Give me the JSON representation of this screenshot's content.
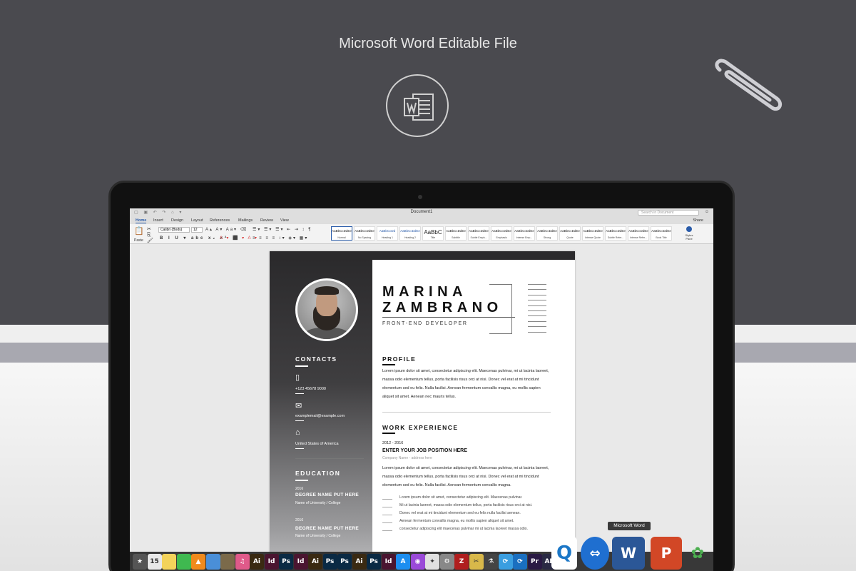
{
  "banner": {
    "headline": "Microsoft Word Editable File"
  },
  "word_window": {
    "title": "Document1",
    "search_placeholder": "Search in Document",
    "tabs": [
      "Home",
      "Insert",
      "Design",
      "Layout",
      "References",
      "Mailings",
      "Review",
      "View"
    ],
    "active_tab": "Home",
    "share_label": "Share",
    "paste_label": "Paste",
    "font_name": "Calibri (Body)",
    "font_size": "12",
    "styles": [
      {
        "sample": "AaBbCcDdEe",
        "name": "Normal"
      },
      {
        "sample": "AaBbCcDdEe",
        "name": "No Spacing"
      },
      {
        "sample": "AaBbCcDd",
        "name": "Heading 1"
      },
      {
        "sample": "AaBbCcDdEe",
        "name": "Heading 2"
      },
      {
        "sample": "AaBbC",
        "name": "Title"
      },
      {
        "sample": "AaBbCcDdEe",
        "name": "Subtitle"
      },
      {
        "sample": "AaBbCcDdEe",
        "name": "Subtle Emph..."
      },
      {
        "sample": "AaBbCcDdEe",
        "name": "Emphasis"
      },
      {
        "sample": "AaBbCcDdEe",
        "name": "Intense Emp..."
      },
      {
        "sample": "AaBbCcDdEe",
        "name": "Strong"
      },
      {
        "sample": "AaBbCcDdEe",
        "name": "Quote"
      },
      {
        "sample": "AaBbCcDdEe",
        "name": "Intense Quote"
      },
      {
        "sample": "AaBbCcDdEe",
        "name": "Subtle Refer..."
      },
      {
        "sample": "AaBbCcDdEe",
        "name": "Intense Refer..."
      },
      {
        "sample": "AaBbCcDdEe",
        "name": "Book Title"
      }
    ],
    "styles_panel_label": "Styles Pane"
  },
  "resume": {
    "first_name": "MARINA",
    "last_name": "ZAMBRANO",
    "role": "FRONT-END DEVELOPER",
    "contacts_heading": "CONTACTS",
    "phone": "+123 45678 9000",
    "email": "examplemail@example.com",
    "address": "United States of America",
    "education_heading": "EDUCATION",
    "education": [
      {
        "year": "2016",
        "degree": "DEGREE NAME PUT HERE",
        "school": "Name of University / College"
      },
      {
        "year": "2016",
        "degree": "DEGREE NAME PUT HERE",
        "school": "Name of University / College"
      }
    ],
    "profile_heading": "PROFILE",
    "profile_lines": [
      "Lorem ipsum dolor sit amet, consectetur adipiscing elit. Maecenas pulvinar, mi ut lacinia laoreet,",
      "massa odio elementum tellus, porta facilisis risus orci at nisi. Donec vel erat at mi tincidunt",
      "elementum sed eu felis. Nulla facilisi. Aenean fermentum convallis magna, eu mollis sapien",
      "aliquet sit amet. Aenean nec mauris tellus."
    ],
    "work_heading": "WORK EXPERIENCE",
    "job": {
      "years": "2012 - 2016",
      "title": "ENTER YOUR JOB POSITION HERE",
      "company": "Company Name - address here",
      "description_lines": [
        "Lorem ipsum dolor sit amet, consectetur adipiscing elit. Maecenas pulvinar, mi ut lacinia laoreet,",
        "massa odio elementum tellus, porta facilisis risus orci at nisi. Donec vel erat at mi tincidunt",
        "elementum sed eu felis. Nulla facilisi. Aenean fermentum convallis magna."
      ],
      "bullets": [
        "Lorem ipsum dolor sit amet, consectetur adipiscing elit. Maecenas pulvinar.",
        "Mi ut lacinia laoreet, massa odio elementum tellus, porta facilisis risus orci at nisi.",
        "Donec vel erat at mi tincidunt elementum sed eu felis nulla facilisi aenean.",
        "Aenean fermentum convallis magna, eu mollis sapien aliquet sit amet.",
        "consectetur adipiscing elit maecenas pulvinar mi ut lacinia laoreet massa odio."
      ]
    }
  },
  "dock": {
    "tooltip": "Microsoft Word",
    "apps": [
      {
        "icon": "star-icon",
        "label": "★",
        "color": "#555"
      },
      {
        "icon": "calendar-icon",
        "label": "15",
        "color": "#e8e8e8"
      },
      {
        "icon": "notes-icon",
        "label": "",
        "color": "#f3d35b"
      },
      {
        "icon": "facetime-icon",
        "label": "",
        "color": "#3fb950"
      },
      {
        "icon": "vlc-icon",
        "label": "▲",
        "color": "#f08a1c"
      },
      {
        "icon": "preview-icon",
        "label": "",
        "color": "#4a8fd8"
      },
      {
        "icon": "keynote-icon",
        "label": "",
        "color": "#7b6a4a"
      },
      {
        "icon": "itunes-icon",
        "label": "♫",
        "color": "#e05a8a"
      },
      {
        "icon": "illustrator-icon",
        "label": "Ai",
        "color": "#3a2a12"
      },
      {
        "icon": "indesign-icon",
        "label": "Id",
        "color": "#4a1530"
      },
      {
        "icon": "photoshop-icon",
        "label": "Ps",
        "color": "#0a2a44"
      },
      {
        "icon": "indesign-icon",
        "label": "Id",
        "color": "#4a1530"
      },
      {
        "icon": "illustrator-icon",
        "label": "Ai",
        "color": "#3a2a12"
      },
      {
        "icon": "photoshop-icon",
        "label": "Ps",
        "color": "#0a2a44"
      },
      {
        "icon": "photoshop-icon",
        "label": "Ps",
        "color": "#0a2a44"
      },
      {
        "icon": "illustrator-icon",
        "label": "Ai",
        "color": "#3a2a12"
      },
      {
        "icon": "photoshop-icon",
        "label": "Ps",
        "color": "#0a2a44"
      },
      {
        "icon": "indesign-icon",
        "label": "Id",
        "color": "#4a1530"
      },
      {
        "icon": "app-store-icon",
        "label": "A",
        "color": "#1c8ef0"
      },
      {
        "icon": "podcast-icon",
        "label": "◉",
        "color": "#9a4ad8"
      },
      {
        "icon": "safari-icon",
        "label": "✦",
        "color": "#e0e0e0"
      },
      {
        "icon": "system-icon",
        "label": "⚙",
        "color": "#888"
      },
      {
        "icon": "filezilla-icon",
        "label": "Z",
        "color": "#b01e1e"
      },
      {
        "icon": "scissors-icon",
        "label": "✂",
        "color": "#d8b84a"
      },
      {
        "icon": "utility-icon",
        "label": "⚗",
        "color": "#444"
      },
      {
        "icon": "sync-icon",
        "label": "⟳",
        "color": "#3a9ee0"
      },
      {
        "icon": "sync-icon",
        "label": "⟳",
        "color": "#1a6fc0"
      },
      {
        "icon": "premiere-icon",
        "label": "Pr",
        "color": "#2a1a44"
      },
      {
        "icon": "after-effects-icon",
        "label": "AE",
        "color": "#2a2a44"
      }
    ]
  }
}
